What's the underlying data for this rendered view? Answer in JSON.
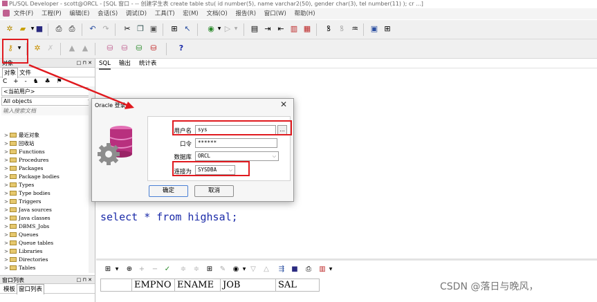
{
  "window": {
    "title": "PL/SQL Developer - scott@ORCL - [SQL 窗口 - -- 创建学生表 create table stu( id number(5), name varchar2(50), gender char(3), tel number(11) ); cr ...]"
  },
  "menubar": {
    "items": [
      "文件(F)",
      "工程(P)",
      "编辑(E)",
      "会话(S)",
      "调试(D)",
      "工具(T)",
      "宏(M)",
      "文档(O)",
      "报告(R)",
      "窗口(W)",
      "帮助(H)"
    ]
  },
  "object_panel": {
    "header": "对象",
    "tabs": [
      "对象",
      "文件"
    ],
    "tools": "C + - ♞ ♣ ⚑",
    "user_combo": "<当前用户>",
    "filter_combo": "All objects",
    "search_placeholder": "输入搜索文档",
    "tree": [
      "最近对象",
      "回收站",
      "Functions",
      "Procedures",
      "Packages",
      "Package bodies",
      "Types",
      "Type bodies",
      "Triggers",
      "Java sources",
      "Java classes",
      "DBMS_Jobs",
      "Queues",
      "Queue tables",
      "Libraries",
      "Directories",
      "Tables"
    ]
  },
  "window_list": {
    "header": "窗口列表",
    "tabs": [
      "模板",
      "窗口列表"
    ]
  },
  "editor": {
    "tabs": [
      "SQL",
      "输出",
      "统计表"
    ],
    "sql": "select * from highsal;"
  },
  "grid": {
    "columns": [
      "EMPNO",
      "ENAME",
      "JOB",
      "SAL"
    ]
  },
  "dialog": {
    "title": "Oracle 登录",
    "username_label": "用户名",
    "username_value": "sys",
    "password_label": "口令",
    "password_value": "******",
    "database_label": "数据库",
    "database_value": "ORCL",
    "connect_as_label": "连接为",
    "connect_as_value": "SYSDBA",
    "browse_label": "...",
    "ok_label": "确定",
    "cancel_label": "取消"
  },
  "icons": {
    "dropdown": "chevron-down-icon",
    "close": "close-icon",
    "logo": "database-gear-icon"
  },
  "colors": {
    "annotation_red": "#e0191e",
    "sql_keyword_blue": "#1a2aa8",
    "default_button_border": "#4a7fd4"
  },
  "watermark": "CSDN @落日与晚风，"
}
